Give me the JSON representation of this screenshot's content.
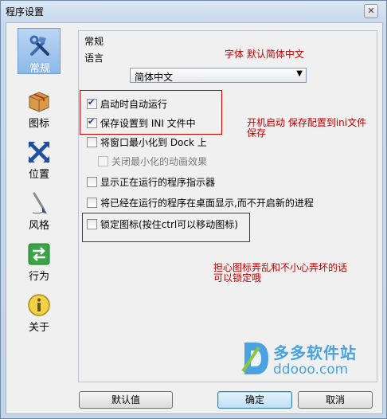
{
  "window": {
    "title": "程序设置",
    "close_glyph": "✕"
  },
  "sidebar": {
    "items": [
      {
        "label": "常规",
        "icon": "tools-icon",
        "active": true
      },
      {
        "label": "图标",
        "icon": "package-icon",
        "active": false
      },
      {
        "label": "位置",
        "icon": "cross-arrows-icon",
        "active": false
      },
      {
        "label": "风格",
        "icon": "brush-icon",
        "active": false
      },
      {
        "label": "行为",
        "icon": "arrows-icon",
        "active": false
      },
      {
        "label": "关于",
        "icon": "info-icon",
        "active": false
      }
    ]
  },
  "general": {
    "section_title": "常规",
    "language_label": "语言",
    "language_value": "简体中文",
    "options": [
      {
        "label": "启动时自动运行",
        "checked": true,
        "enabled": true
      },
      {
        "label": "保存设置到 INI 文件中",
        "checked": true,
        "enabled": true
      },
      {
        "label": "将窗口最小化到 Dock 上",
        "checked": false,
        "enabled": true
      },
      {
        "label": "关闭最小化的动画效果",
        "checked": false,
        "enabled": false
      },
      {
        "label": "显示正在运行的程序指示器",
        "checked": false,
        "enabled": true
      },
      {
        "label": "将已经在运行的程序在桌面显示,而不开启新的进程",
        "checked": false,
        "enabled": true
      },
      {
        "label": "锁定图标(按住ctrl可以移动图标)",
        "checked": false,
        "enabled": true
      }
    ]
  },
  "annotations": {
    "font": "字体  默认简体中文",
    "autostart_line1": "开机启动  保存配置到ini文件",
    "autostart_line2": "保存",
    "lock_line1": "担心图标弄乱和不小心弄坏的话",
    "lock_line2": "可以锁定哦"
  },
  "watermark": {
    "brand": "多多软件站",
    "url": "ddooo.com"
  },
  "buttons": {
    "default": "默认值",
    "ok": "确定",
    "cancel": "取消"
  },
  "colors": {
    "annotation": "#c00000",
    "accent": "#4aa3e0"
  }
}
